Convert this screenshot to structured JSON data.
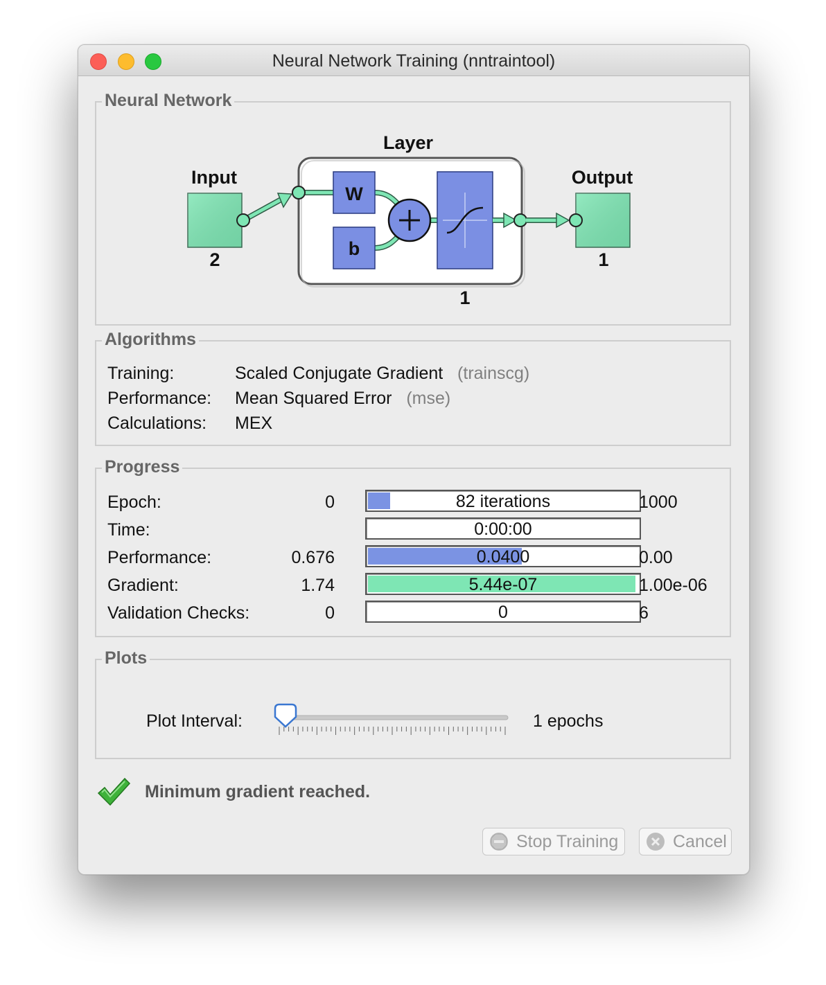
{
  "window": {
    "title": "Neural Network Training (nntraintool)"
  },
  "neural_network": {
    "legend": "Neural Network",
    "input_label": "Input",
    "input_size": "2",
    "layer_label": "Layer",
    "weight_label": "W",
    "bias_label": "b",
    "layer_size": "1",
    "output_label": "Output",
    "output_size": "1",
    "node_color": "#7ee6b4",
    "block_color": "#7b8fe3"
  },
  "algorithms": {
    "legend": "Algorithms",
    "rows": [
      {
        "label": "Training:",
        "value": "Scaled Conjugate Gradient",
        "code": "(trainscg)"
      },
      {
        "label": "Performance:",
        "value": "Mean Squared Error",
        "code": "(mse)"
      },
      {
        "label": "Calculations:",
        "value": "MEX",
        "code": ""
      }
    ]
  },
  "progress": {
    "legend": "Progress",
    "rows": [
      {
        "label": "Epoch:",
        "start": "0",
        "current": "82 iterations",
        "end": "1000",
        "fraction": 0.082,
        "color": "#7b93e3"
      },
      {
        "label": "Time:",
        "start": "",
        "current": "0:00:00",
        "end": "",
        "fraction": 0,
        "color": "#7b93e3"
      },
      {
        "label": "Performance:",
        "start": "0.676",
        "current": "0.0400",
        "end": "0.00",
        "fraction": 0.57,
        "color": "#7b93e3"
      },
      {
        "label": "Gradient:",
        "start": "1.74",
        "current": "5.44e-07",
        "end": "1.00e-06",
        "fraction": 0.99,
        "color": "#7ee6b4"
      },
      {
        "label": "Validation Checks:",
        "start": "0",
        "current": "0",
        "end": "6",
        "fraction": 0,
        "color": "#7b93e3"
      }
    ]
  },
  "plots": {
    "legend": "Plots",
    "interval_label": "Plot Interval:",
    "interval_value": "1 epochs",
    "slider_value": 1
  },
  "status": {
    "message": "Minimum gradient reached.",
    "icon": "checkmark-icon"
  },
  "buttons": {
    "stop_label": "Stop Training",
    "stop_icon": "stop-icon",
    "cancel_label": "Cancel",
    "cancel_icon": "cancel-x-icon"
  }
}
